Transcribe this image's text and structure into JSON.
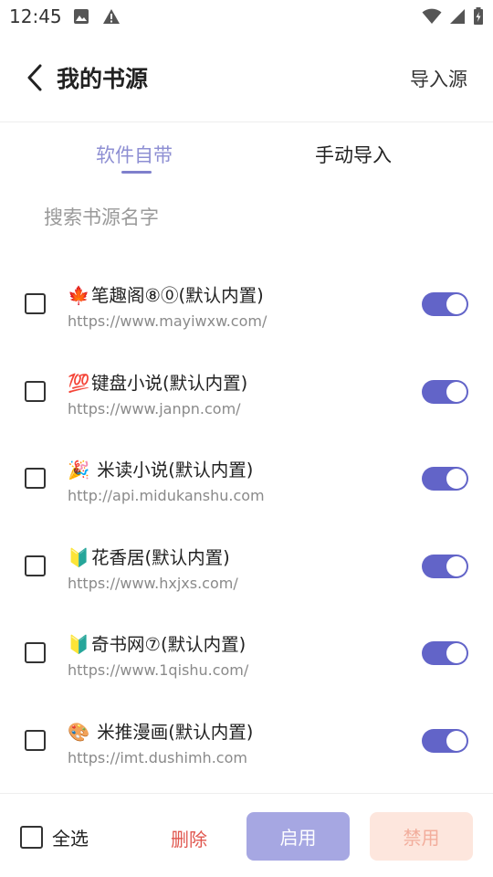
{
  "status_bar": {
    "time": "12:45",
    "left_icons": [
      "image-icon",
      "warning-icon"
    ],
    "right_icons": [
      "wifi-icon",
      "signal-icon",
      "battery-icon"
    ]
  },
  "header": {
    "title": "我的书源",
    "action_label": "导入源"
  },
  "tabs": [
    {
      "label": "软件自带",
      "active": true
    },
    {
      "label": "手动导入",
      "active": false
    }
  ],
  "search": {
    "placeholder": "搜索书源名字",
    "value": ""
  },
  "sources": [
    {
      "emoji": "🍁",
      "name": "笔趣阁⑧⓪(默认内置)",
      "url": "https://www.mayiwxw.com/",
      "checked": false,
      "enabled": true
    },
    {
      "emoji": "💯",
      "name": "键盘小说(默认内置)",
      "url": "https://www.janpn.com/",
      "checked": false,
      "enabled": true
    },
    {
      "emoji": "🎉",
      "name": " 米读小说(默认内置)",
      "url": "http://api.midukanshu.com",
      "checked": false,
      "enabled": true
    },
    {
      "emoji": "🔰",
      "name": "花香居(默认内置)",
      "url": "https://www.hxjxs.com/",
      "checked": false,
      "enabled": true
    },
    {
      "emoji": "🔰",
      "name": "奇书网⑦(默认内置)",
      "url": "https://www.1qishu.com/",
      "checked": false,
      "enabled": true
    },
    {
      "emoji": "🎨",
      "name": " 米推漫画(默认内置)",
      "url": "https://imt.dushimh.com",
      "checked": false,
      "enabled": true
    }
  ],
  "bottom_bar": {
    "select_all_label": "全选",
    "delete_label": "删除",
    "enable_label": "启用",
    "disable_label": "禁用"
  },
  "colors": {
    "accent": "#6264c8",
    "tab_active": "#8e8fd3",
    "enable_button": "#a6a7e2",
    "delete_text": "#e0574f",
    "disable_button_bg": "#fde6dd",
    "disable_button_text": "#f2ad9c"
  }
}
